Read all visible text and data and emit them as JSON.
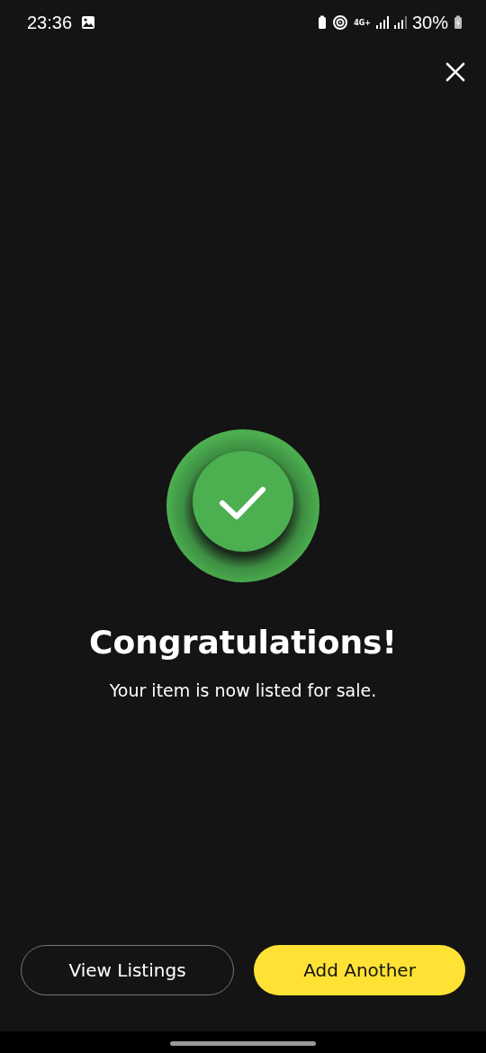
{
  "status_bar": {
    "time": "23:36",
    "network": "4G+",
    "battery": "30%"
  },
  "success": {
    "title": "Congratulations!",
    "message": "Your item is now listed for sale."
  },
  "buttons": [
    {
      "label": "View Listings",
      "kind": "outline"
    },
    {
      "label": "Add Another",
      "kind": "primary"
    }
  ]
}
